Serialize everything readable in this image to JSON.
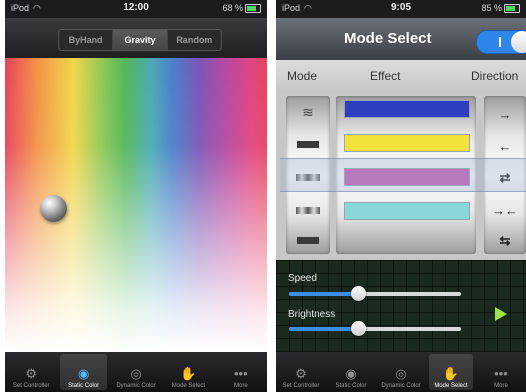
{
  "left": {
    "status": {
      "carrier": "iPod",
      "time": "12:00",
      "battery": "68 %"
    },
    "segments": [
      {
        "label": "ByHand",
        "active": false
      },
      {
        "label": "Gravity",
        "active": true
      },
      {
        "label": "Random",
        "active": false
      }
    ],
    "tabs": [
      {
        "label": "Set Controller",
        "icon": "gear-icon",
        "active": false
      },
      {
        "label": "Static Color",
        "icon": "eye-icon",
        "active": true
      },
      {
        "label": "Dynamic Color",
        "icon": "dynamic-eye-icon",
        "active": false
      },
      {
        "label": "Mode Select",
        "icon": "hand-icon",
        "active": false
      },
      {
        "label": "More",
        "icon": "more-dots-icon",
        "active": false
      }
    ]
  },
  "right": {
    "status": {
      "carrier": "iPod",
      "time": "9:05",
      "battery": "85 %"
    },
    "title": "Mode Select",
    "toggle_on": true,
    "columns": {
      "mode": "Mode",
      "effect": "Effect",
      "direction": "Direction"
    },
    "effect_colors": [
      "#2e3fc2",
      "#f2e23a",
      "#c85bb4",
      "#8ad7d9"
    ],
    "direction_glyphs": [
      "→",
      "←",
      "⇄",
      "→←",
      "⇆"
    ],
    "sliders": {
      "speed_label": "Speed",
      "speed_value": 0.4,
      "brightness_label": "Brightness",
      "brightness_value": 0.4
    },
    "tabs": [
      {
        "label": "Set Controller",
        "icon": "gear-icon",
        "active": false
      },
      {
        "label": "Static Color",
        "icon": "eye-icon",
        "active": false
      },
      {
        "label": "Dynamic Color",
        "icon": "dynamic-eye-icon",
        "active": false
      },
      {
        "label": "Mode Select",
        "icon": "hand-icon",
        "active": true
      },
      {
        "label": "More",
        "icon": "more-dots-icon",
        "active": false
      }
    ]
  }
}
